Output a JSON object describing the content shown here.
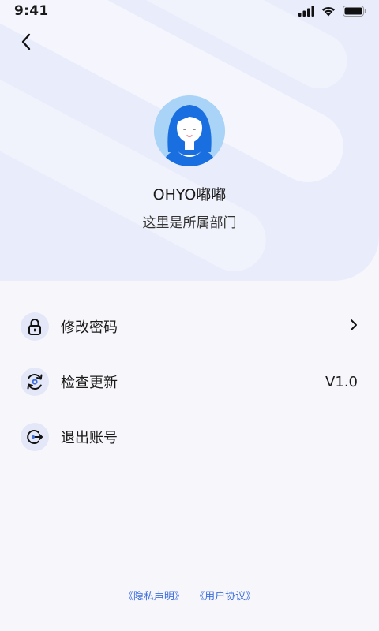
{
  "status_bar": {
    "time": "9:41"
  },
  "profile": {
    "username": "OHYO嘟嘟",
    "department": "这里是所属部门"
  },
  "menu": {
    "items": [
      {
        "label": "修改密码",
        "icon": "lock-icon",
        "right": ""
      },
      {
        "label": "检查更新",
        "icon": "refresh-gear-icon",
        "right": "V1.0"
      },
      {
        "label": "退出账号",
        "icon": "logout-icon",
        "right": ""
      }
    ]
  },
  "footer": {
    "privacy": "《隐私声明》",
    "agreement": "《用户协议》"
  },
  "colors": {
    "accent": "#3d6fe0",
    "header_bg": "#e9ecfb",
    "page_bg": "#f7f7fb"
  }
}
